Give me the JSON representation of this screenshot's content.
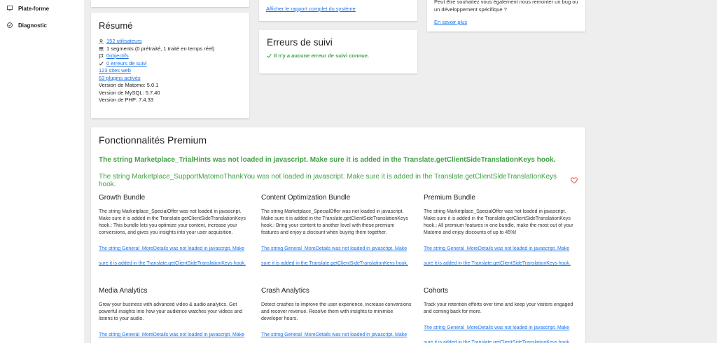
{
  "sidebar": {
    "items": [
      {
        "label": "Plate-forme",
        "icon": "monitor-icon"
      },
      {
        "label": "Diagnostic",
        "icon": "check-circle-icon"
      }
    ]
  },
  "system": {
    "full_report_link": "Afficher le rapport complet du système"
  },
  "support": {
    "text": "Peut être souhaitez vous également nous remonter un bug ou un développement spécifique ?",
    "link": "En savoir plus"
  },
  "resume": {
    "title": "Résumé",
    "users": "152 utilisateurs",
    "segments": "1 segments (0 prétraité, 1 traité en temps réel)",
    "goals": "0objectifs",
    "errors": "0 erreurs de suivi",
    "websites": "123 sites web",
    "plugins": "53 plugins activés",
    "matomo_version": "Version de Matomo: 5.0.1",
    "mysql_version": "Version de MySQL: 5.7.40",
    "php_version": "Version de PHP: 7.4.33"
  },
  "tracking_errors": {
    "title": "Erreurs de suivi",
    "message": "Il n'y a aucune erreur de suivi connue."
  },
  "premium": {
    "title": "Fonctionnalités Premium",
    "trial_hint": "The string Marketplace_TrialHints was not loaded in javascript. Make sure it is added in the Translate.getClientSideTranslationKeys hook.",
    "thank_you": "The string Marketplace_SupportMatomoThankYou was not loaded in javascript. Make sure it is added in the Translate.getClientSideTranslationKeys hook.",
    "more_details_line1": "The string General_MoreDetails was not loaded in javascript. Make",
    "more_details_line2": "sure it is added in the Translate.getClientSideTranslationKeys hook.",
    "bundles": [
      {
        "title": "Growth Bundle",
        "desc": "The string Marketplace_SpecialOffer was not loaded in javascript. Make sure it is added in the Translate.getClientSideTranslationKeys hook.: This bundle lets you optimize your content, increase your conversions, and gives you insights into your user acquisition."
      },
      {
        "title": "Content Optimization Bundle",
        "desc": "The string Marketplace_SpecialOffer was not loaded in javascript. Make sure it is added in the Translate.getClientSideTranslationKeys hook.: Bring your content to another level with these premium features and enjoy a discount when buying them together."
      },
      {
        "title": "Premium Bundle",
        "desc": "The string Marketplace_SpecialOffer was not loaded in javascript. Make sure it is added in the Translate.getClientSideTranslationKeys hook.: All premium features in one bundle, make the most out of your Matomo and enjoy discounts of up to 45%!"
      },
      {
        "title": "Media Analytics",
        "desc": "Grow your business with advanced video & audio analytics. Get powerful insights into how your audience watches your videos and listens to your audio."
      },
      {
        "title": "Crash Analytics",
        "desc": "Detect crashes to improve the user experience, increase conversions and recover revenue. Resolve them with insights to minimise developer hours."
      },
      {
        "title": "Cohorts",
        "desc": "Track your retention efforts over time and keep your visitors engaged and coming back for more."
      }
    ]
  },
  "colors": {
    "success": "#43a047",
    "link": "#1a73e8",
    "heart": "#e53935"
  }
}
